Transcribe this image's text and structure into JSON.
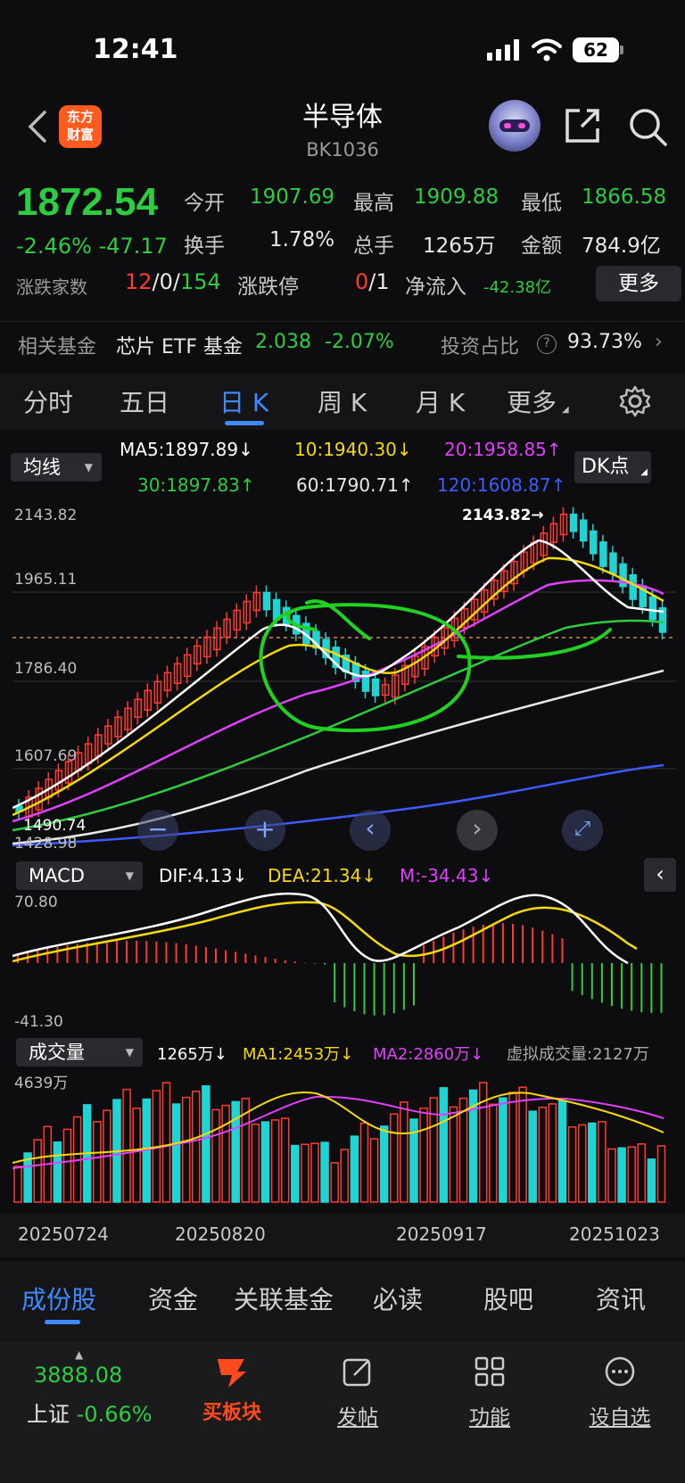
{
  "status": {
    "time": "12:41",
    "battery": "62"
  },
  "header": {
    "logo": "东方\n财富",
    "title": "半导体",
    "code": "BK1036"
  },
  "quote": {
    "price": "1872.54",
    "change": "-2.46% -47.17",
    "open_label": "今开",
    "open": "1907.69",
    "high_label": "最高",
    "high": "1909.88",
    "low_label": "最低",
    "low": "1866.58",
    "turnover_label": "换手",
    "turnover": "1.78%",
    "vol_label": "总手",
    "vol": "1265万",
    "amount_label": "金额",
    "amount": "784.9亿",
    "breadth_label": "涨跌家数",
    "up": "12",
    "flat": "0",
    "down": "154",
    "limit_label": "涨跌停",
    "limit_up": "0",
    "limit_down": "1",
    "inflow_label": "净流入",
    "inflow": "-42.38亿",
    "more": "更多"
  },
  "fund": {
    "label": "相关基金",
    "name": "芯片 ETF 基金",
    "price": "2.038",
    "pct": "-2.07%",
    "ratio_label": "投资占比",
    "ratio": "93.73%"
  },
  "tabs": [
    "分时",
    "五日",
    "日 K",
    "周 K",
    "月 K",
    "更多"
  ],
  "ma": {
    "selector": "均线",
    "ma5": "MA5:1897.89↓",
    "ma10": "10:1940.30↓",
    "ma20": "20:1958.85↑",
    "ma30": "30:1897.83↑",
    "ma60": "60:1790.71↑",
    "ma120": "120:1608.87↑",
    "dk": "DK点"
  },
  "main_axis": {
    "y1": "2143.82",
    "y2": "1965.11",
    "y3": "1786.40",
    "y4": "1607.69",
    "y5": "1428.98",
    "low_mark": "1490.74",
    "high_mark": "2143.82→"
  },
  "macd": {
    "selector": "MACD",
    "dif": "DIF:4.13↓",
    "dea": "DEA:21.34↓",
    "m": "M:-34.43↓",
    "top": "70.80",
    "bottom": "-41.30"
  },
  "volume": {
    "selector": "成交量",
    "vol": "1265万↓",
    "ma1": "MA1:2453万↓",
    "ma2": "MA2:2860万↓",
    "virtual": "虚拟成交量:2127万",
    "top": "4639万"
  },
  "dates": [
    "20250724",
    "20250820",
    "20250917",
    "20251023"
  ],
  "bottom_tabs": [
    "成份股",
    "资金",
    "关联基金",
    "必读",
    "股吧",
    "资讯"
  ],
  "footer": {
    "index_value": "3888.08",
    "index_name": "上证",
    "index_pct": "-0.66%",
    "buy": "买板块",
    "post": "发帖",
    "func": "功能",
    "watch": "设自选"
  },
  "colors": {
    "up": "#ff3b30",
    "down": "#2ecc40",
    "accent": "#3d8bff",
    "cyan": "#22d3d3"
  }
}
